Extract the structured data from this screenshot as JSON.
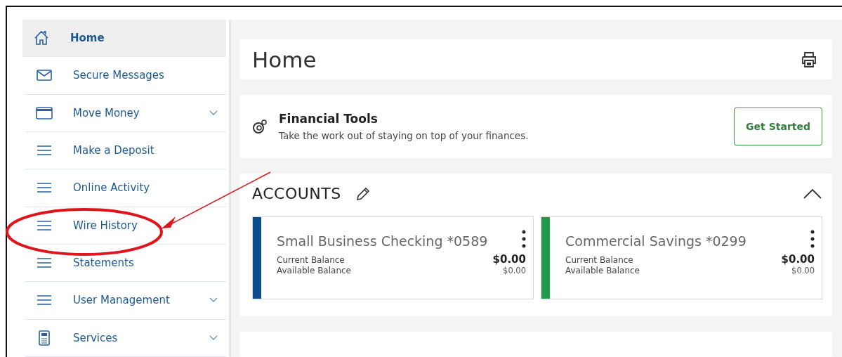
{
  "sidebar": {
    "items": [
      {
        "label": "Home",
        "kind": "home",
        "selected": true,
        "expandable": false
      },
      {
        "label": "Secure Messages",
        "kind": "mail",
        "selected": false,
        "expandable": false
      },
      {
        "label": "Move Money",
        "kind": "card",
        "selected": false,
        "expandable": true
      },
      {
        "label": "Make a Deposit",
        "kind": "list",
        "selected": false,
        "expandable": false
      },
      {
        "label": "Online Activity",
        "kind": "list",
        "selected": false,
        "expandable": false
      },
      {
        "label": "Wire History",
        "kind": "list",
        "selected": false,
        "expandable": false,
        "highlighted": true
      },
      {
        "label": "Statements",
        "kind": "list",
        "selected": false,
        "expandable": false
      },
      {
        "label": "User Management",
        "kind": "list",
        "selected": false,
        "expandable": true
      },
      {
        "label": "Services",
        "kind": "calculator",
        "selected": false,
        "expandable": true
      }
    ]
  },
  "page_title": "Home",
  "financial_tools": {
    "title": "Financial Tools",
    "description": "Take the work out of staying on top of your finances.",
    "button": "Get Started"
  },
  "accounts": {
    "title": "ACCOUNTS",
    "expanded": true,
    "items": [
      {
        "name": "Small Business Checking *0589",
        "color": "#0b4d8c",
        "current_label": "Current Balance",
        "current": "$0.00",
        "available_label": "Available Balance",
        "available": "$0.00"
      },
      {
        "name": "Commercial Savings *0299",
        "color": "#1f9a48",
        "current_label": "Current Balance",
        "current": "$0.00",
        "available_label": "Available Balance",
        "available": "$0.00"
      }
    ]
  }
}
